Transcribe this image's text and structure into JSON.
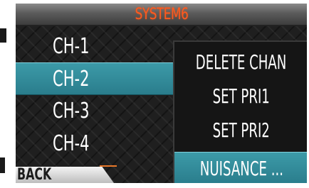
{
  "screen": {
    "title": "SYSTEM6"
  },
  "channels": [
    {
      "label": "CH-1",
      "selected": false
    },
    {
      "label": "CH-2",
      "selected": true
    },
    {
      "label": "CH-3",
      "selected": false
    },
    {
      "label": "CH-4",
      "selected": false
    }
  ],
  "back_label": "BACK",
  "popup_menu": {
    "items": [
      {
        "label": "DELETE CHAN",
        "selected": false
      },
      {
        "label": "SET PRI1",
        "selected": false
      },
      {
        "label": "SET PRI2",
        "selected": false
      },
      {
        "label": "NUISANCE ...",
        "selected": true
      }
    ]
  },
  "colors": {
    "title_text": "#ff5a1f",
    "selection": "#2f8a98",
    "background": "#1f1f1f"
  }
}
